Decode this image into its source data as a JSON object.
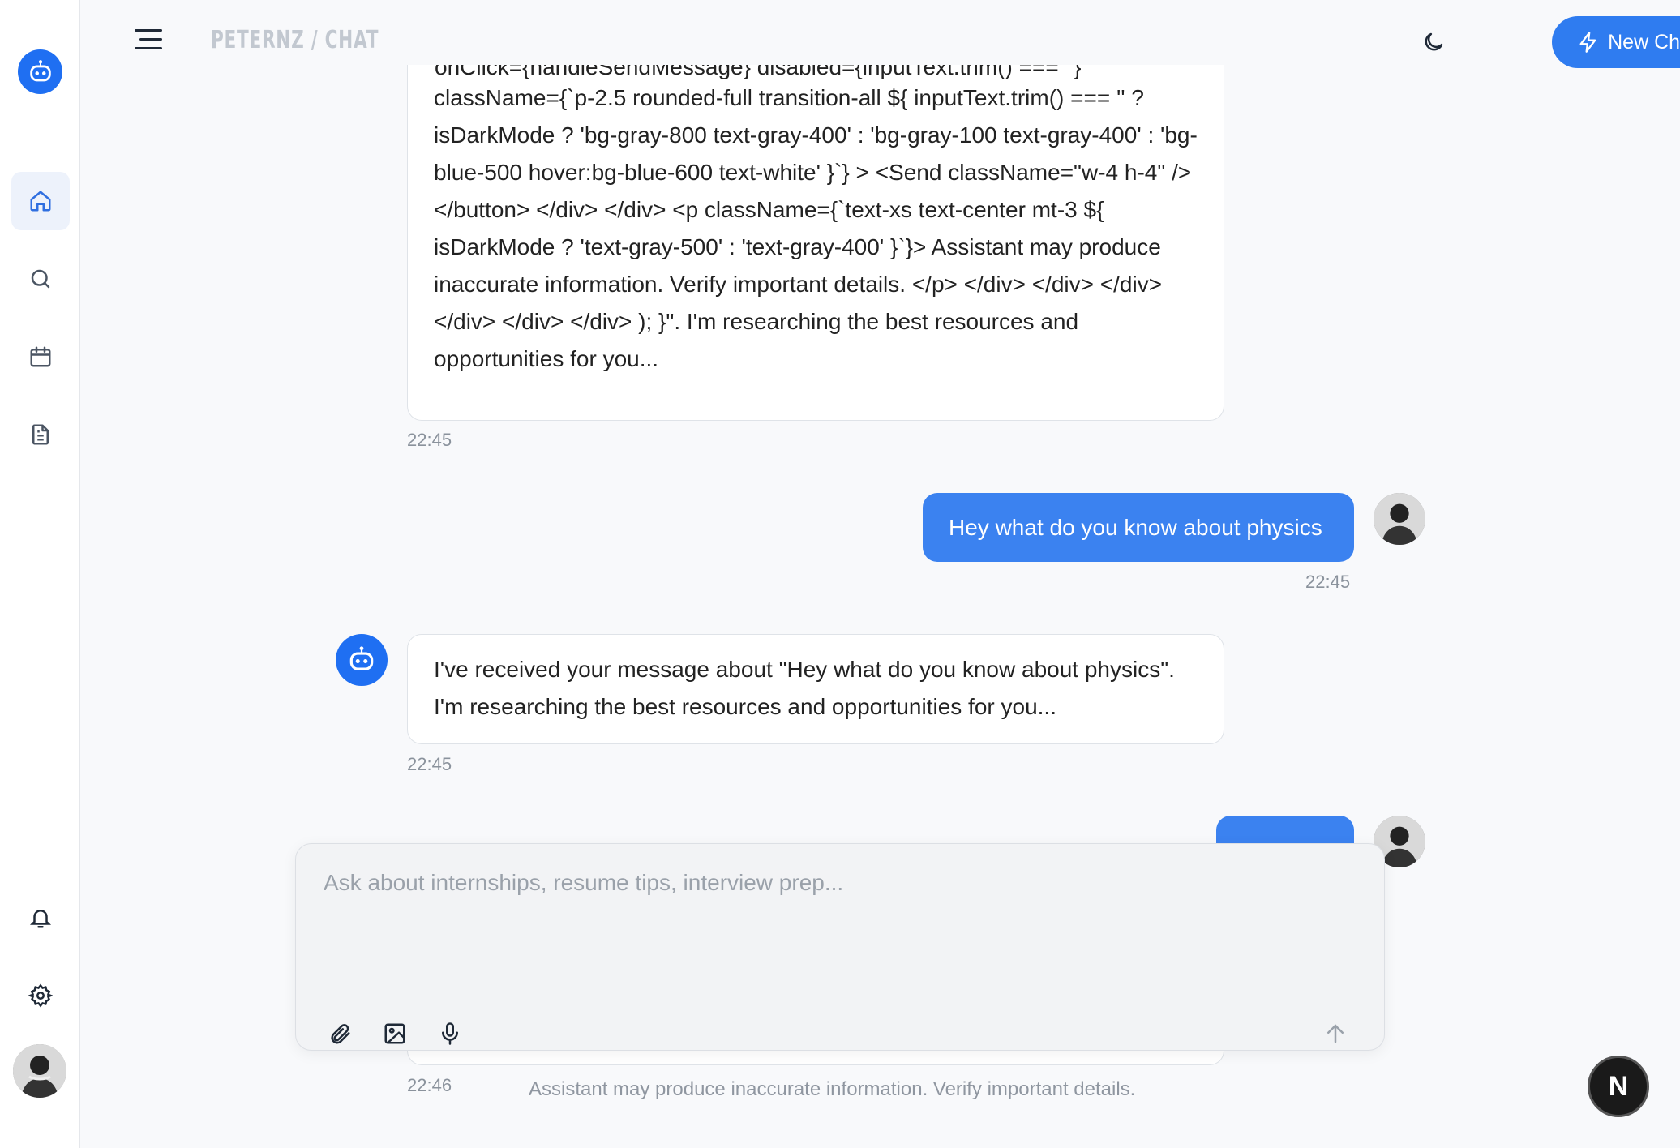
{
  "header": {
    "brand": "PETERNZ / CHAT",
    "new_chat_label": "New Chat"
  },
  "sidebar": {
    "items": [
      {
        "name": "home",
        "icon": "home-icon"
      },
      {
        "name": "search",
        "icon": "search-icon"
      },
      {
        "name": "calendar",
        "icon": "calendar-icon"
      },
      {
        "name": "documents",
        "icon": "document-icon"
      }
    ],
    "bottom": [
      {
        "name": "notifications",
        "icon": "bell-icon"
      },
      {
        "name": "settings",
        "icon": "gear-icon"
      }
    ]
  },
  "messages": [
    {
      "role": "assistant",
      "top_fragment": "onClick={handleSendMessage} disabled={inputText.trim() === ''}",
      "text": "className={`p-2.5 rounded-full transition-all ${ inputText.trim() === '' ? isDarkMode ? 'bg-gray-800 text-gray-400' : 'bg-gray-100 text-gray-400' : 'bg-blue-500 hover:bg-blue-600 text-white' }`} > <Send className=\"w-4 h-4\" /> </button> </div> </div> <p className={`text-xs text-center mt-3 ${ isDarkMode ? 'text-gray-500' : 'text-gray-400' }`}> Assistant may produce inaccurate information. Verify important details. </p> </div> </div> </div> </div> </div> </div> ); }\". I'm researching the best resources and opportunities for you...",
      "time": "22:45"
    },
    {
      "role": "user",
      "text": "Hey what do you know about physics",
      "time": "22:45"
    },
    {
      "role": "assistant",
      "text": "I've received your message about \"Hey what do you know about physics\". I'm researching the best resources and opportunities for you...",
      "time": "22:45"
    },
    {
      "role": "user",
      "text": "",
      "time": ""
    },
    {
      "role": "assistant",
      "text": "",
      "time": "22:46"
    }
  ],
  "composer": {
    "placeholder": "Ask about internships, resume tips, interview prep..."
  },
  "disclaimer": "Assistant may produce inaccurate information. Verify important details.",
  "fab_label": "N",
  "colors": {
    "accent": "#2f7cf0",
    "user_bubble": "#3b82f0",
    "bot_avatar": "#1f6ff2"
  }
}
